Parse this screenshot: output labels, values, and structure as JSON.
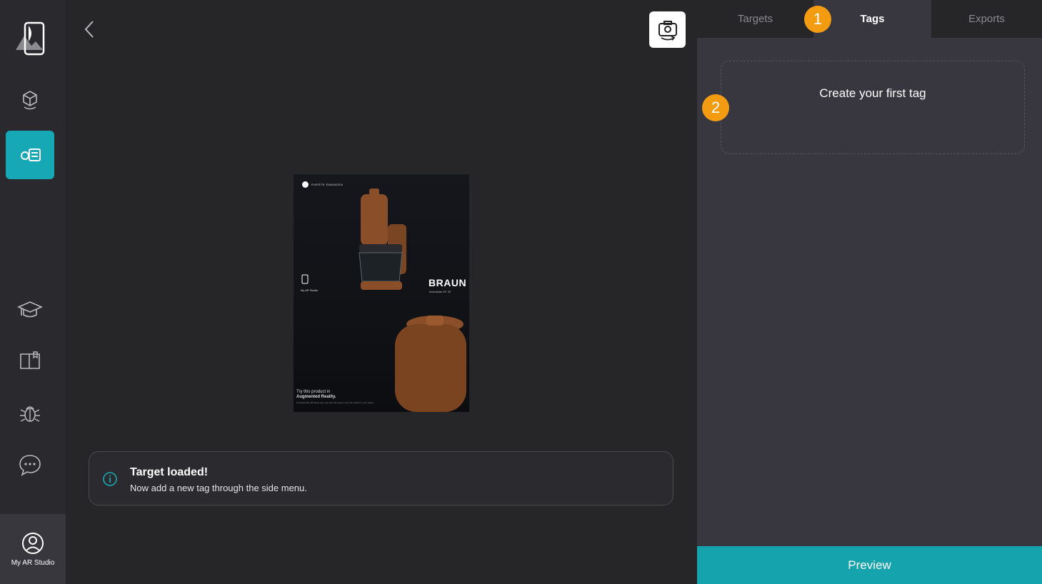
{
  "sidebar": {
    "items": [
      {
        "icon": "cube-ar-icon"
      },
      {
        "icon": "tag-target-icon",
        "active": true
      },
      {
        "icon": "graduation-cap-icon"
      },
      {
        "icon": "book-icon"
      },
      {
        "icon": "bug-icon"
      },
      {
        "icon": "chat-icon"
      }
    ],
    "profile_label": "My AR Studio"
  },
  "canvas": {
    "target_image": {
      "brand_small": "PUERTE EMANDEN",
      "brand_logo": "BRAUN",
      "brand_sub": "Aromaster KF 20",
      "studio_small": "My AR Studio",
      "try_text_line1": "Try this product in",
      "try_text_line2": "Augmented Reality.",
      "fine_print": "Download My AR Studio app and scan this page to see the product in your space."
    },
    "toast": {
      "title": "Target loaded!",
      "message": "Now add a new tag through the side menu."
    }
  },
  "panel": {
    "tabs": [
      {
        "label": "Targets",
        "active": false
      },
      {
        "label": "Tags",
        "active": true
      },
      {
        "label": "Exports",
        "active": false
      }
    ],
    "badges": [
      "1",
      "2"
    ],
    "create_tag_label": "Create your first tag",
    "preview_label": "Preview"
  },
  "colors": {
    "accent": "#17a8b5",
    "badge": "#f39c12",
    "panel_bg": "#38373f",
    "canvas_bg": "#262629"
  }
}
